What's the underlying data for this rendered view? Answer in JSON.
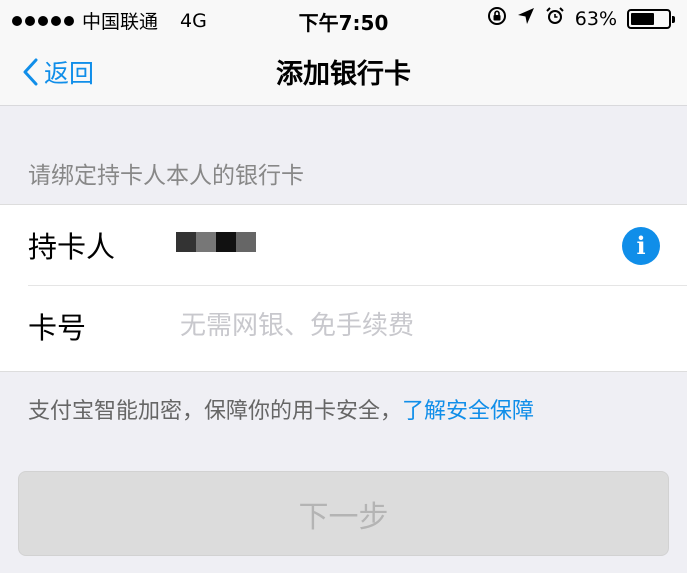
{
  "status_bar": {
    "carrier": "中国联通",
    "network": "4G",
    "time": "下午7:50",
    "battery_text": "63%",
    "battery_level": 0.63
  },
  "nav": {
    "back_label": "返回",
    "title": "添加银行卡"
  },
  "hint": "请绑定持卡人本人的银行卡",
  "form": {
    "holder_label": "持卡人",
    "card_label": "卡号",
    "card_placeholder": "无需网银、免手续费",
    "card_value": ""
  },
  "security": {
    "text": "支付宝智能加密，保障你的用卡安全，",
    "link": "了解安全保障"
  },
  "next_button": "下一步",
  "icons": {
    "back": "chevron-left-icon",
    "info": "info-icon",
    "rotation_lock": "rotation-lock-icon",
    "location": "location-arrow-icon",
    "alarm": "alarm-icon",
    "battery": "battery-icon"
  },
  "colors": {
    "accent": "#108ee9",
    "background": "#efeff4",
    "button_disabled": "#dcdcdc"
  }
}
